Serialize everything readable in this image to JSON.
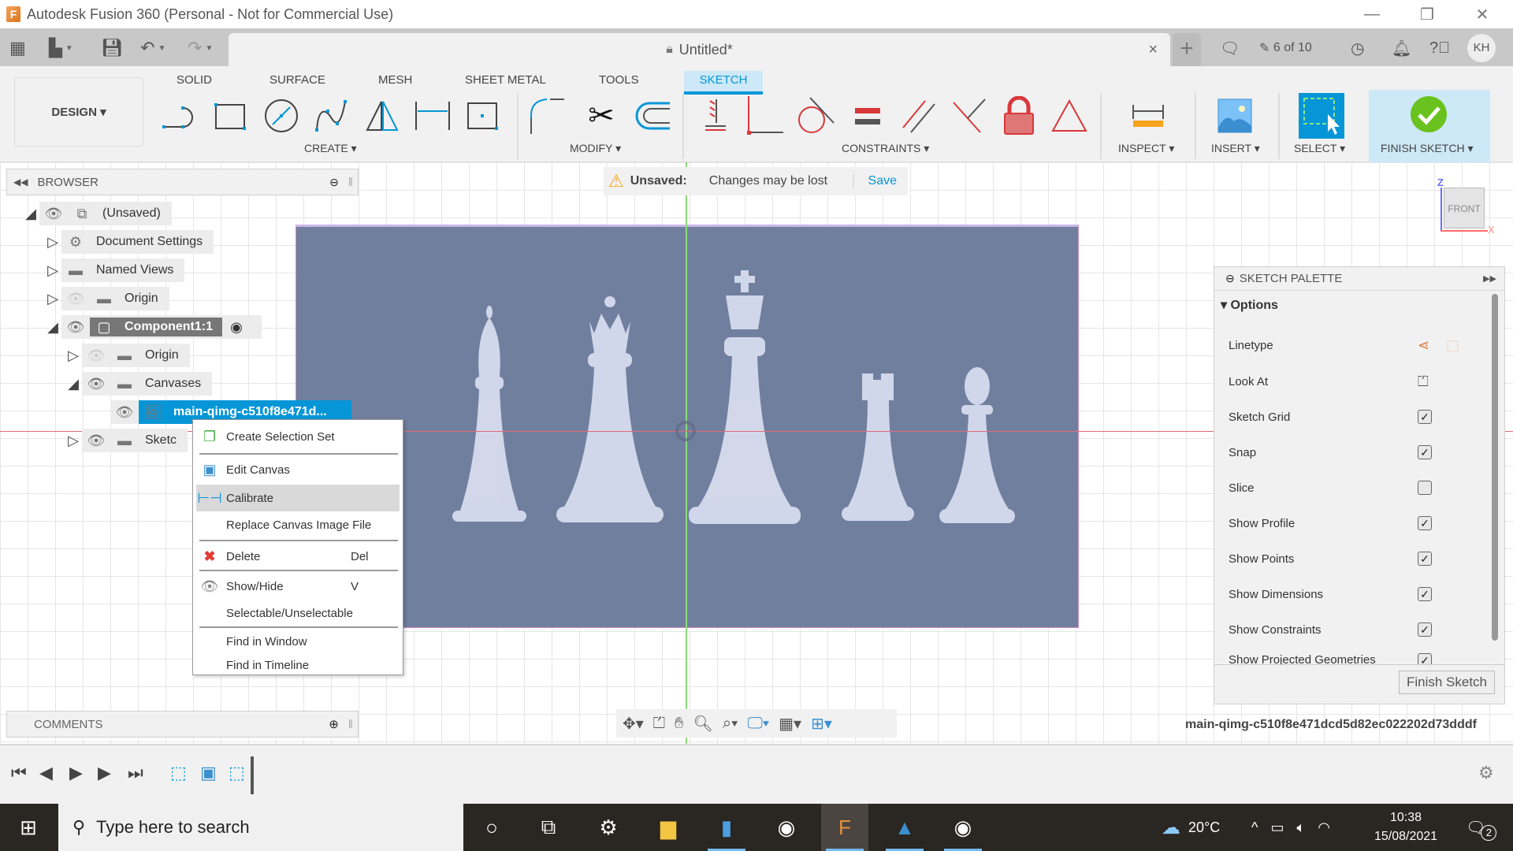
{
  "window": {
    "title": "Autodesk Fusion 360 (Personal - Not for Commercial Use)",
    "app_icon": "fusion-360-logo",
    "controls": [
      "minimize-icon",
      "restore-icon",
      "close-icon"
    ]
  },
  "tabbar": {
    "document_title": "Untitled*",
    "close_label": "×",
    "new_tab_label": "+",
    "jobs_status": "6 of 10",
    "user_initials": "KH"
  },
  "ribbon": {
    "workspace": "DESIGN ▾",
    "tabs": [
      "SOLID",
      "SURFACE",
      "MESH",
      "SHEET METAL",
      "TOOLS",
      "SKETCH"
    ],
    "active_tab": "SKETCH",
    "groups": {
      "create": "CREATE ▾",
      "modify": "MODIFY ▾",
      "constraints": "CONSTRAINTS ▾",
      "inspect": "INSPECT ▾",
      "insert": "INSERT ▾",
      "select": "SELECT ▾",
      "finish": "FINISH SKETCH ▾"
    },
    "create_tools": [
      "line-icon",
      "rectangle-icon",
      "circle-icon",
      "spline-icon",
      "mirror-icon",
      "dimension-icon",
      "point-icon"
    ],
    "modify_tools": [
      "fillet-icon",
      "trim-icon",
      "offset-icon"
    ],
    "constraint_tools": [
      "fix-icon",
      "coincident-icon",
      "tangent-icon",
      "equal-icon",
      "parallel-icon",
      "perpendicular-icon",
      "lock-icon",
      "midpoint-icon"
    ]
  },
  "notice": {
    "label": "Unsaved:",
    "message": "Changes may be lost",
    "action": "Save"
  },
  "browser": {
    "title": "BROWSER",
    "tree": [
      {
        "label": "(Unsaved)",
        "level": 0,
        "expanded": true
      },
      {
        "label": "Document Settings",
        "level": 1,
        "expanded": false
      },
      {
        "label": "Named Views",
        "level": 1,
        "expanded": false
      },
      {
        "label": "Origin",
        "level": 1,
        "expanded": false
      },
      {
        "label": "Component1:1",
        "level": 1,
        "expanded": true
      },
      {
        "label": "Origin",
        "level": 2,
        "expanded": false
      },
      {
        "label": "Canvases",
        "level": 2,
        "expanded": true
      },
      {
        "label": "main-qimg-c510f8e471d...",
        "level": 3,
        "selected": true
      },
      {
        "label": "Sketc",
        "level": 2,
        "expanded": false
      }
    ]
  },
  "context_menu": {
    "items": [
      {
        "label": "Create Selection Set",
        "icon": "selection-set-icon",
        "shortcut": ""
      },
      {
        "label": "Edit Canvas",
        "icon": "image-icon",
        "shortcut": ""
      },
      {
        "label": "Calibrate",
        "icon": "calibrate-icon",
        "shortcut": "",
        "highlighted": true
      },
      {
        "label": "Replace Canvas Image File",
        "icon": "",
        "shortcut": ""
      },
      {
        "label": "Delete",
        "icon": "delete-x-icon",
        "shortcut": "Del"
      },
      {
        "label": "Show/Hide",
        "icon": "eye-icon",
        "shortcut": "V"
      },
      {
        "label": "Selectable/Unselectable",
        "icon": "",
        "shortcut": ""
      },
      {
        "label": "Find in Window",
        "icon": "",
        "shortcut": ""
      },
      {
        "label": "Find in Timeline",
        "icon": "",
        "shortcut": ""
      }
    ]
  },
  "viewcube": {
    "face": "FRONT",
    "axis_z": "Z",
    "axis_x": "X"
  },
  "sketch_palette": {
    "title": "SKETCH PALETTE",
    "section": "Options",
    "rows": [
      {
        "label": "Linetype",
        "type": "icons"
      },
      {
        "label": "Look At",
        "type": "button"
      },
      {
        "label": "Sketch Grid",
        "type": "checkbox",
        "checked": true
      },
      {
        "label": "Snap",
        "type": "checkbox",
        "checked": true
      },
      {
        "label": "Slice",
        "type": "checkbox",
        "checked": false
      },
      {
        "label": "Show Profile",
        "type": "checkbox",
        "checked": true
      },
      {
        "label": "Show Points",
        "type": "checkbox",
        "checked": true
      },
      {
        "label": "Show Dimensions",
        "type": "checkbox",
        "checked": true
      },
      {
        "label": "Show Constraints",
        "type": "checkbox",
        "checked": true
      },
      {
        "label": "Show Projected Geometries",
        "type": "checkbox",
        "checked": true
      }
    ],
    "finish_button": "Finish Sketch"
  },
  "canvas_name": "main-qimg-c510f8e471dcd5d82ec022202d73dddf",
  "comments": {
    "title": "COMMENTS"
  },
  "navbar": [
    "orbit-icon",
    "look-at-icon",
    "pan-icon",
    "zoom-icon",
    "fit-icon",
    "display-settings-icon",
    "grid-settings-icon",
    "viewports-icon"
  ],
  "taskbar": {
    "search_placeholder": "Type here to search",
    "weather": "20°C",
    "time": "10:38",
    "date": "15/08/2021",
    "notifications": "2"
  },
  "colors": {
    "accent": "#0696d7",
    "canvas_bg": "#717f9f",
    "finish_green": "#6ac21e",
    "constraint_red": "#d9383a"
  }
}
